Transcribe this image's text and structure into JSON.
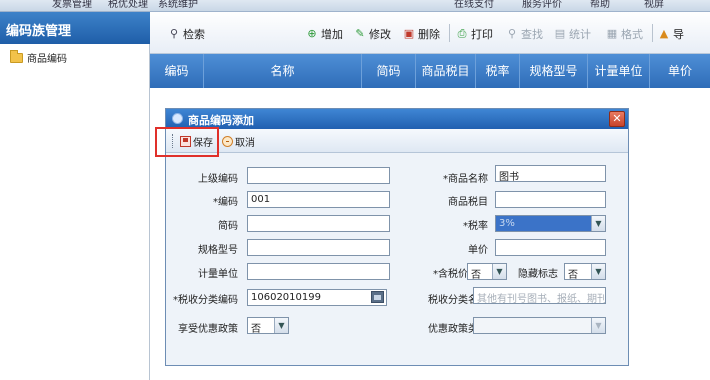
{
  "top_menu": [
    "发票管理",
    "税优处理",
    "系统维护",
    "在线支付",
    "服务评价",
    "帮助",
    "视屏"
  ],
  "left": {
    "title": "编码族管理",
    "tree_item": "商品编码"
  },
  "toolbar": {
    "search": "检索",
    "add": "增加",
    "edit": "修改",
    "delete": "删除",
    "print": "打印",
    "find": "查找",
    "stats": "统计",
    "format": "格式",
    "export": "导"
  },
  "grid": {
    "columns": [
      "编码",
      "名称",
      "简码",
      "商品税目",
      "税率",
      "规格型号",
      "计量单位",
      "单价"
    ]
  },
  "dialog": {
    "title": "商品编码添加",
    "close": "✕",
    "save_label": "保存",
    "cancel_label": "取消",
    "labels": {
      "parent_code": "上级编码",
      "code": "*编码",
      "short_code": "简码",
      "spec": "规格型号",
      "unit": "计量单位",
      "tax_class_code": "*税收分类编码",
      "preferential": "享受优惠政策",
      "product_name": "*商品名称",
      "tax_item": "商品税目",
      "tax_rate": "*税率",
      "price": "单价",
      "tax_inclusive": "*含税价标志",
      "hidden_flag": "隐藏标志",
      "tax_class_name": "税收分类名称",
      "preferential_type": "优惠政策类型"
    },
    "values": {
      "parent_code": "",
      "code": "001",
      "short_code": "",
      "spec": "",
      "unit": "",
      "tax_class_code": "10602010199",
      "preferential": "否",
      "product_name": "图书",
      "tax_item": "",
      "tax_rate": "3%",
      "price": "",
      "tax_inclusive": "否",
      "hidden_flag": "否",
      "tax_class_name": "其他有刊号图书、报纸、期刊",
      "preferential_type": ""
    }
  }
}
